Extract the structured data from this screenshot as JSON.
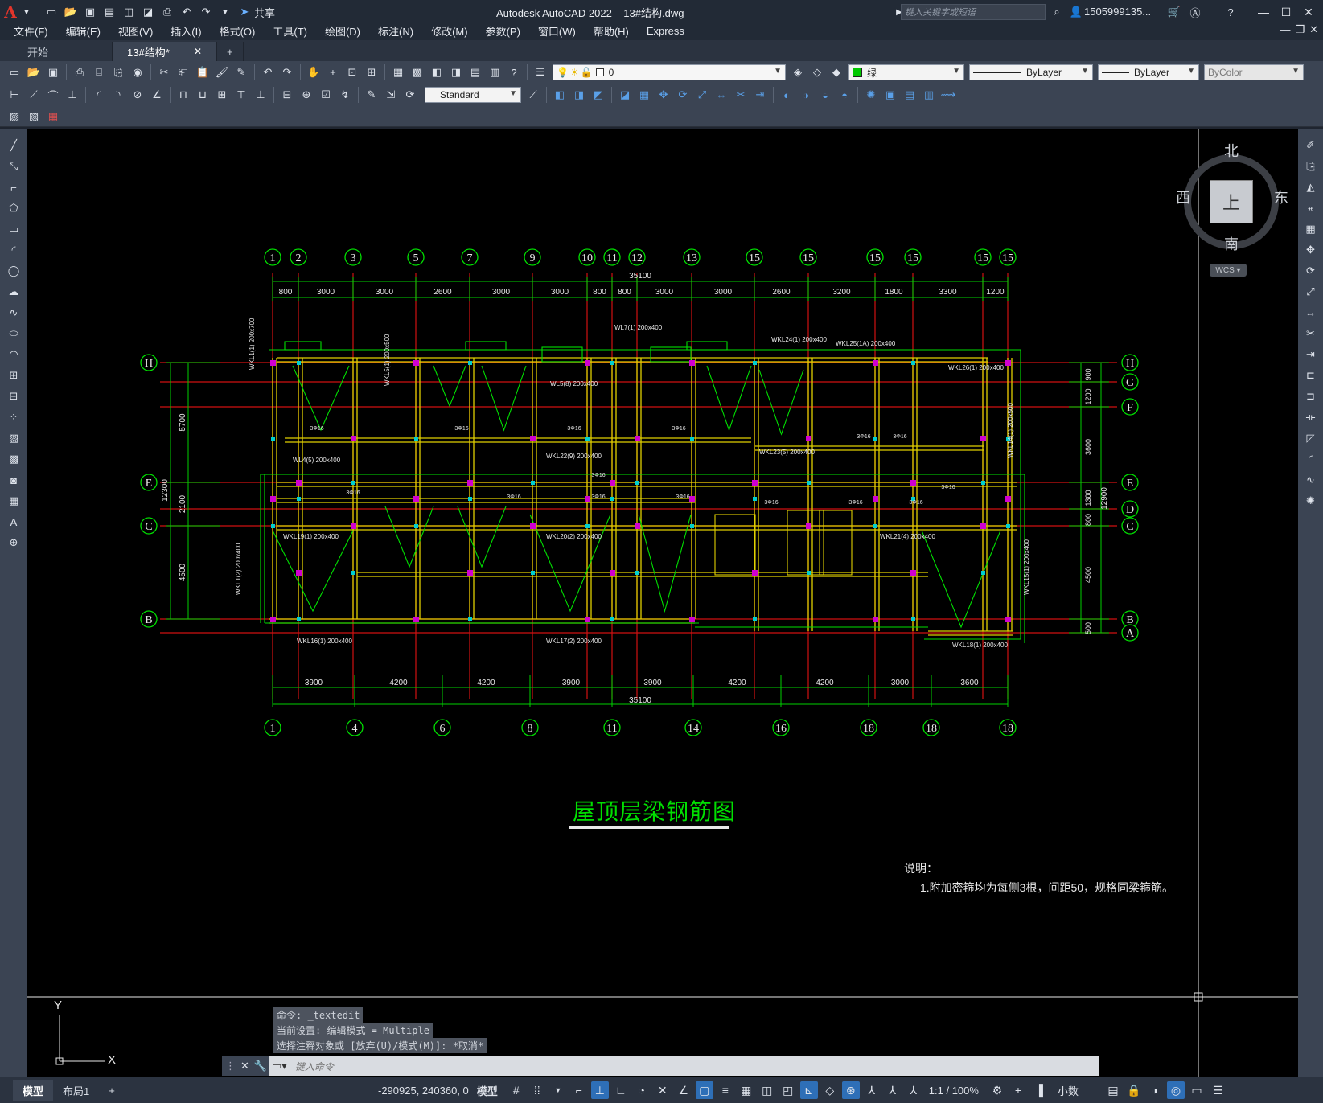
{
  "app": {
    "title": "Autodesk AutoCAD 2022",
    "filename": "13#结构.dwg",
    "share_label": "共享",
    "search_placeholder": "键入关键字或短语",
    "user": "1505999135...",
    "logo": "A"
  },
  "menu": [
    "文件(F)",
    "编辑(E)",
    "视图(V)",
    "插入(I)",
    "格式(O)",
    "工具(T)",
    "绘图(D)",
    "标注(N)",
    "修改(M)",
    "参数(P)",
    "窗口(W)",
    "帮助(H)",
    "Express"
  ],
  "tabs": [
    {
      "label": "开始"
    },
    {
      "label": "13#结构*"
    }
  ],
  "toolbar": {
    "layer_value": "0",
    "color_value": "绿",
    "linetype_value": "ByLayer",
    "lineweight_value": "ByLayer",
    "plotstyle_value": "ByColor",
    "dimstyle_value": "Standard",
    "color_swatch": "#00c800"
  },
  "viewcube": {
    "north": "北",
    "south": "南",
    "east": "东",
    "west": "西",
    "top": "上",
    "wcs": "WCS"
  },
  "drawing": {
    "title": "屋顶层梁钢筋图",
    "note_title": "说明：",
    "note_text": "1.附加密箍均为每侧3根，间距50，规格同梁箍筋。",
    "top_axes": [
      "1",
      "2",
      "3",
      "5",
      "7",
      "9",
      "10",
      "11",
      "12",
      "13",
      "15",
      "15",
      "15",
      "15",
      "15",
      "15"
    ],
    "bottom_axes": [
      "1",
      "4",
      "6",
      "8",
      "11",
      "14",
      "16",
      "18",
      "18",
      "18"
    ],
    "left_axes": [
      "H",
      "E",
      "C",
      "B"
    ],
    "right_axes": [
      "H",
      "G",
      "F",
      "E",
      "D",
      "C",
      "B",
      "A"
    ],
    "top_dims": [
      "800",
      "3000",
      "3000",
      "2600",
      "3000",
      "3000",
      "800",
      "800",
      "3000",
      "3000",
      "2600",
      "3200",
      "1800",
      "3300",
      "1200"
    ],
    "top_total": "35100",
    "bottom_dims": [
      "3900",
      "4200",
      "4200",
      "3900",
      "3900",
      "4200",
      "4200",
      "3000",
      "3600"
    ],
    "bottom_total": "35100",
    "left_dims": [
      "5700",
      "2100",
      "4500"
    ],
    "left_total": "12300",
    "right_dims": [
      "900",
      "1200",
      "3600",
      "1300",
      "800",
      "4500",
      "500"
    ],
    "right_total": "12900"
  },
  "command": {
    "history": [
      "命令: _textedit",
      "当前设置: 编辑模式 = Multiple",
      "选择注释对象或 [放弃(U)/模式(M)]: *取消*"
    ],
    "placeholder": "键入命令"
  },
  "status": {
    "layouts": [
      "模型",
      "布局1"
    ],
    "coords": "-290925, 240360, 0",
    "model": "模型",
    "scale": "1:1 / 100%",
    "units": "小数"
  },
  "ucs": {
    "x": "X",
    "y": "Y"
  }
}
